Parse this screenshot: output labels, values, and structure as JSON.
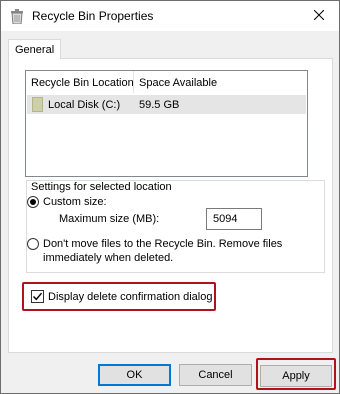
{
  "window": {
    "title": "Recycle Bin Properties",
    "icon": "recycle-bin-icon",
    "close_icon": "close-icon"
  },
  "tabs": [
    {
      "label": "General",
      "active": true
    }
  ],
  "location_list": {
    "columns": [
      "Recycle Bin Location",
      "Space Available"
    ],
    "rows": [
      {
        "icon": "drive-icon",
        "name": "Local Disk (C:)",
        "space": "59.5 GB",
        "selected": true
      }
    ]
  },
  "settings": {
    "group_label": "Settings for selected location",
    "custom_size_label": "Custom size:",
    "custom_size_selected": true,
    "max_size_label": "Maximum size (MB):",
    "max_size_value": "5094",
    "dont_move_label_line1": "Don't move files to the Recycle Bin. Remove files",
    "dont_move_label_line2": "immediately when deleted.",
    "dont_move_selected": false
  },
  "confirmation": {
    "label": "Display delete confirmation dialog",
    "checked": true
  },
  "buttons": {
    "ok": "OK",
    "cancel": "Cancel",
    "apply": "Apply"
  },
  "colors": {
    "highlight": "#b0121b",
    "default_button_border": "#0078d7"
  }
}
